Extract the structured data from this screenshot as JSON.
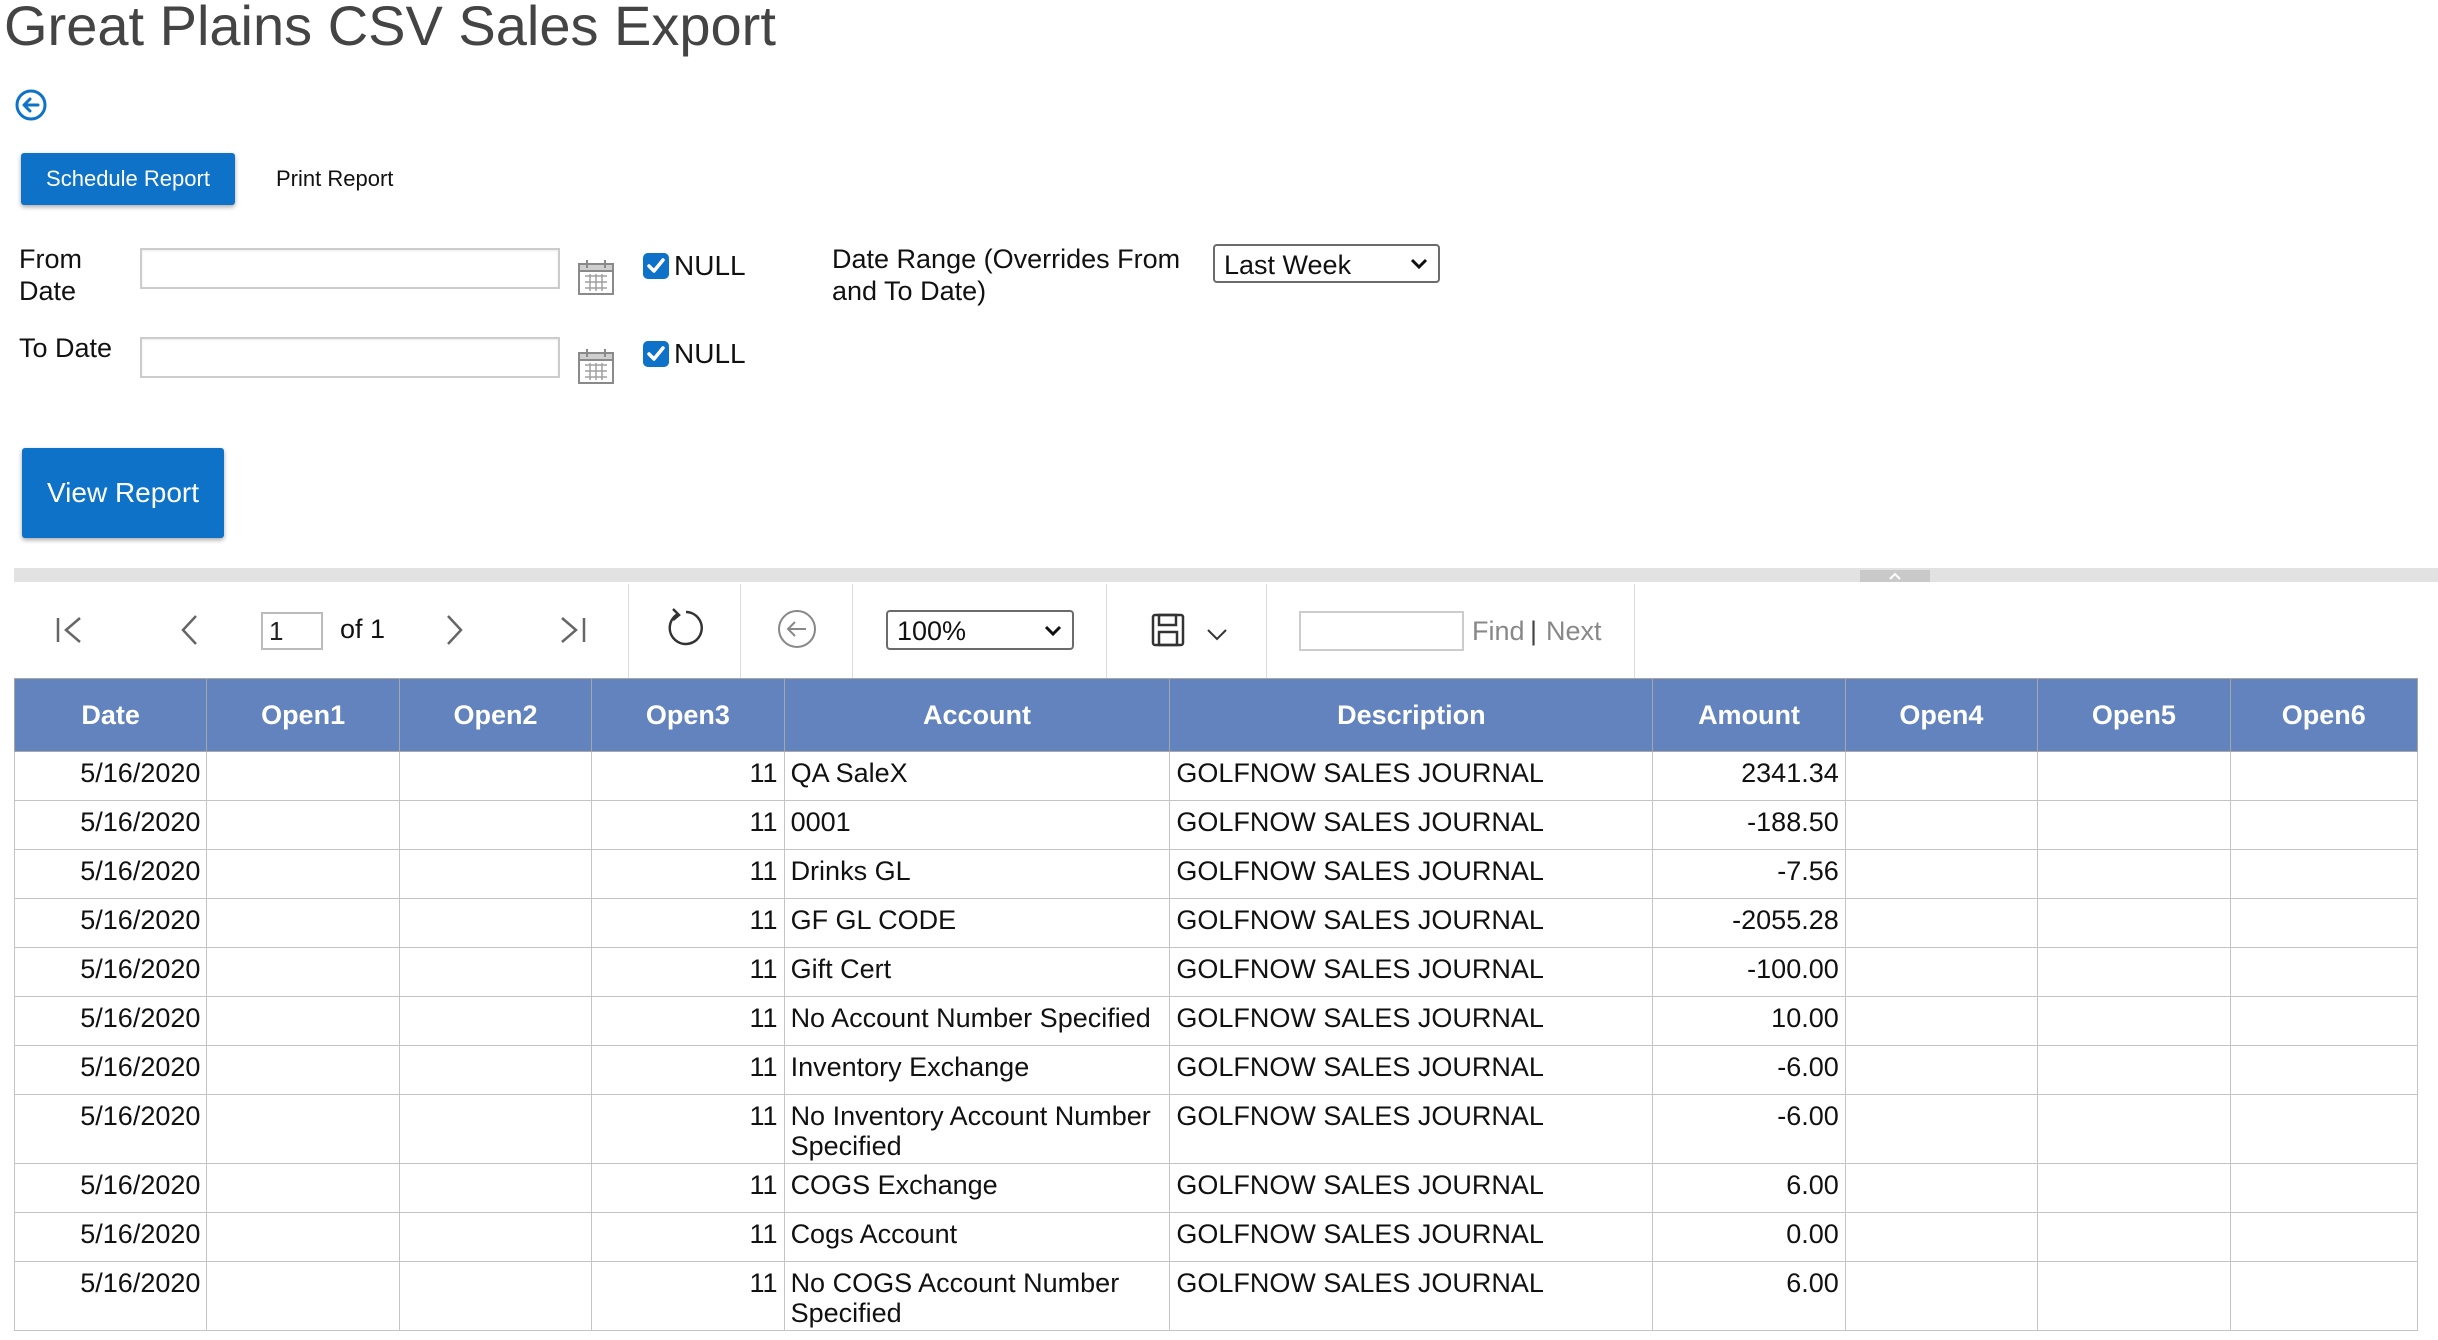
{
  "page": {
    "title": "Great Plains CSV Sales Export"
  },
  "actions": {
    "schedule_label": "Schedule Report",
    "print_label": "Print Report",
    "view_label": "View Report"
  },
  "params": {
    "from_label": "From\nDate",
    "to_label": "To Date",
    "from_value": "",
    "to_value": "",
    "from_null": "NULL",
    "to_null": "NULL",
    "date_range_label": "Date Range (Overrides From\nand To Date)",
    "date_range_value": "Last Week"
  },
  "toolbar": {
    "page_value": "1",
    "page_total_label": "of 1",
    "zoom_value": "100%",
    "find_value": "",
    "find_label": "Find",
    "separator": "|",
    "next_label": "Next"
  },
  "table": {
    "headers": [
      "Date",
      "Open1",
      "Open2",
      "Open3",
      "Account",
      "Description",
      "Amount",
      "Open4",
      "Open5",
      "Open6"
    ],
    "rows": [
      {
        "date": "5/16/2020",
        "open1": "",
        "open2": "",
        "open3": "11",
        "account": "QA SaleX",
        "description": "GOLFNOW SALES JOURNAL",
        "amount": "2341.34",
        "open4": "",
        "open5": "",
        "open6": ""
      },
      {
        "date": "5/16/2020",
        "open1": "",
        "open2": "",
        "open3": "11",
        "account": "0001",
        "description": "GOLFNOW SALES JOURNAL",
        "amount": "-188.50",
        "open4": "",
        "open5": "",
        "open6": ""
      },
      {
        "date": "5/16/2020",
        "open1": "",
        "open2": "",
        "open3": "11",
        "account": "Drinks GL",
        "description": "GOLFNOW SALES JOURNAL",
        "amount": "-7.56",
        "open4": "",
        "open5": "",
        "open6": ""
      },
      {
        "date": "5/16/2020",
        "open1": "",
        "open2": "",
        "open3": "11",
        "account": "GF GL CODE",
        "description": "GOLFNOW SALES JOURNAL",
        "amount": "-2055.28",
        "open4": "",
        "open5": "",
        "open6": ""
      },
      {
        "date": "5/16/2020",
        "open1": "",
        "open2": "",
        "open3": "11",
        "account": "Gift Cert",
        "description": "GOLFNOW SALES JOURNAL",
        "amount": "-100.00",
        "open4": "",
        "open5": "",
        "open6": ""
      },
      {
        "date": "5/16/2020",
        "open1": "",
        "open2": "",
        "open3": "11",
        "account": "No Account Number Specified",
        "description": "GOLFNOW SALES JOURNAL",
        "amount": "10.00",
        "open4": "",
        "open5": "",
        "open6": ""
      },
      {
        "date": "5/16/2020",
        "open1": "",
        "open2": "",
        "open3": "11",
        "account": "Inventory Exchange",
        "description": "GOLFNOW SALES JOURNAL",
        "amount": "-6.00",
        "open4": "",
        "open5": "",
        "open6": ""
      },
      {
        "date": "5/16/2020",
        "open1": "",
        "open2": "",
        "open3": "11",
        "account": "No Inventory Account Number Specified",
        "description": "GOLFNOW SALES JOURNAL",
        "amount": "-6.00",
        "open4": "",
        "open5": "",
        "open6": ""
      },
      {
        "date": "5/16/2020",
        "open1": "",
        "open2": "",
        "open3": "11",
        "account": "COGS Exchange",
        "description": "GOLFNOW SALES JOURNAL",
        "amount": "6.00",
        "open4": "",
        "open5": "",
        "open6": ""
      },
      {
        "date": "5/16/2020",
        "open1": "",
        "open2": "",
        "open3": "11",
        "account": "Cogs Account",
        "description": "GOLFNOW SALES JOURNAL",
        "amount": "0.00",
        "open4": "",
        "open5": "",
        "open6": ""
      },
      {
        "date": "5/16/2020",
        "open1": "",
        "open2": "",
        "open3": "11",
        "account": "No COGS Account Number Specified",
        "description": "GOLFNOW SALES JOURNAL",
        "amount": "6.00",
        "open4": "",
        "open5": "",
        "open6": ""
      }
    ]
  },
  "colors": {
    "accent": "#0d72c8",
    "header_bg": "#6283bd",
    "splitter": "#e2e2e2"
  }
}
